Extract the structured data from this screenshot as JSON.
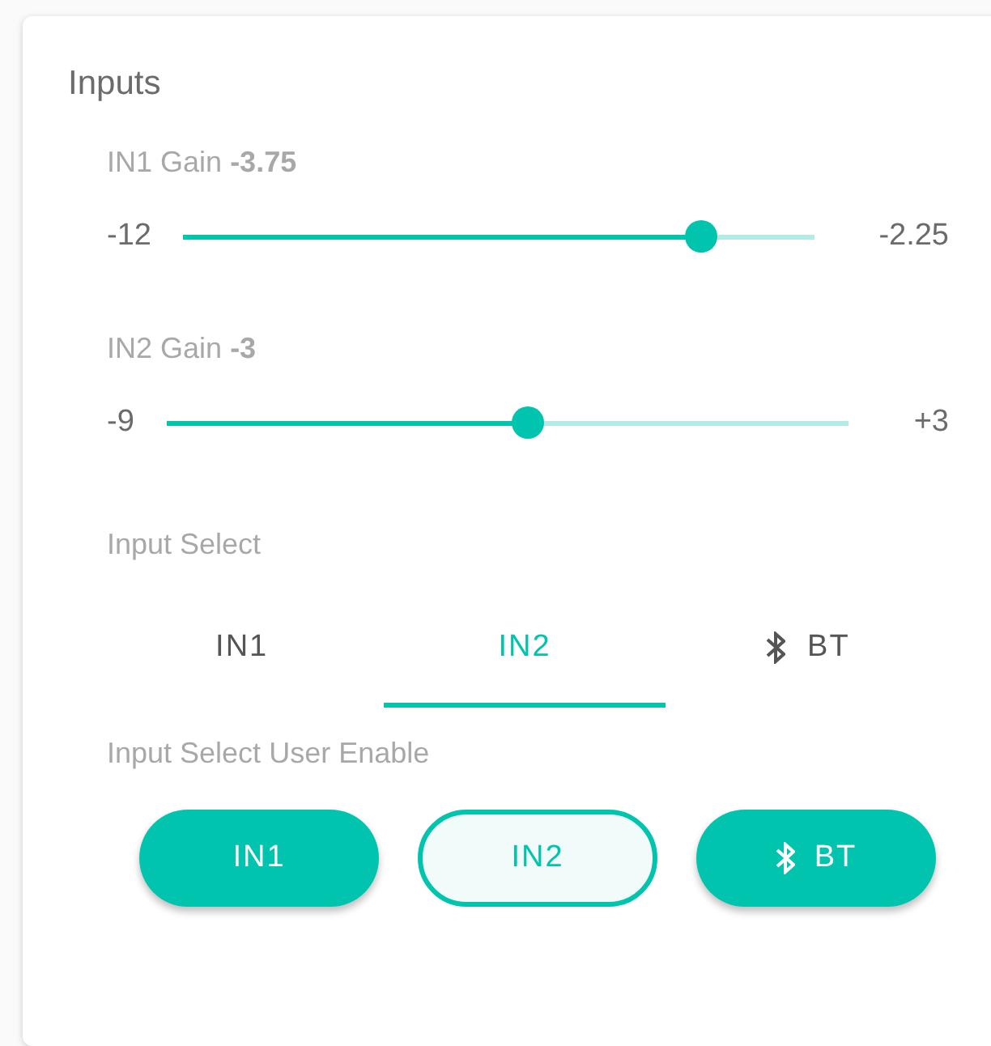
{
  "card": {
    "title": "Inputs"
  },
  "sliders": [
    {
      "label": "IN1 Gain",
      "value": "-3.75",
      "min": "-12",
      "max": "-2.25",
      "level": 0.82
    },
    {
      "label": "IN2 Gain",
      "value": "-3",
      "min": "-9",
      "max": "+3",
      "level": 0.53
    }
  ],
  "input_select": {
    "label": "Input Select",
    "tabs": [
      {
        "label": "IN1",
        "kind": "plain",
        "selected": false
      },
      {
        "label": "IN2",
        "kind": "plain",
        "selected": true
      },
      {
        "label": "BT",
        "kind": "bluetooth",
        "selected": false
      }
    ]
  },
  "user_enable": {
    "label": "Input Select User Enable",
    "buttons": [
      {
        "label": "IN1",
        "kind": "plain",
        "on": true
      },
      {
        "label": "IN2",
        "kind": "plain",
        "on": false
      },
      {
        "label": "BT",
        "kind": "bluetooth",
        "on": true
      }
    ]
  }
}
